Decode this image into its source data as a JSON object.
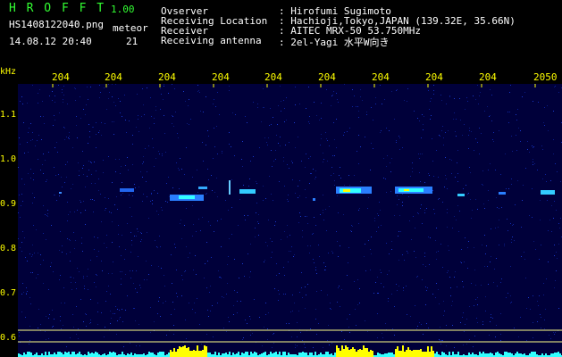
{
  "header": {
    "title": "H R O F F T",
    "version": "1.00",
    "filename": "HS1408122040.png",
    "mode": "meteor",
    "datetime": "14.08.12 20:40",
    "count": "21"
  },
  "info": [
    {
      "label": "Ovserver",
      "value": ": Hirofumi Sugimoto"
    },
    {
      "label": "Receiving Location",
      "value": ": Hachioji,Tokyo,JAPAN (139.32E, 35.66N)"
    },
    {
      "label": "Receiver",
      "value": ": AITEC MRX-50  53.750MHz"
    },
    {
      "label": "Receiving antenna",
      "value": ": 2el-Yagi 水平W向き"
    }
  ],
  "axis": {
    "unit": "kHz",
    "xticks": [
      "204",
      "204",
      "204",
      "204",
      "204",
      "204",
      "204",
      "204",
      "204",
      "204",
      "2050"
    ],
    "yticks": [
      "1.1",
      "1.0",
      "0.9",
      "0.8",
      "0.7",
      "0.6"
    ]
  },
  "colors": {
    "title": "#33ff33",
    "text": "#ffffff",
    "axis": "#ffff00",
    "background": "#000000",
    "spectrum_bg": "#00003a",
    "signal": "#33ffff",
    "hot": "#ffff00"
  }
}
